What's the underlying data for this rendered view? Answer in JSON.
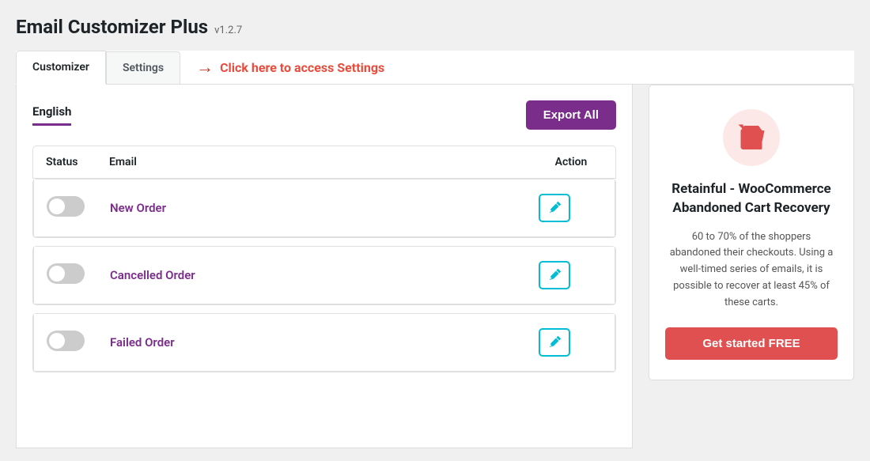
{
  "page": {
    "title": "Email Customizer Plus",
    "version": "v1.2.7"
  },
  "tabs": [
    {
      "id": "customizer",
      "label": "Customizer",
      "active": true
    },
    {
      "id": "settings",
      "label": "Settings",
      "active": false
    }
  ],
  "settings_hint": {
    "arrow": "→",
    "text": "Click here to access Settings"
  },
  "language_tab": {
    "label": "English"
  },
  "export_all_btn": "Export All",
  "table_headers": {
    "status": "Status",
    "email": "Email",
    "action": "Action"
  },
  "email_rows": [
    {
      "id": "new-order",
      "name": "New Order",
      "enabled": false
    },
    {
      "id": "cancelled-order",
      "name": "Cancelled Order",
      "enabled": false
    },
    {
      "id": "failed-order",
      "name": "Failed Order",
      "enabled": false
    }
  ],
  "promo": {
    "title": "Retainful - WooCommerce Abandoned Cart Recovery",
    "description": "60 to 70% of the shoppers abandoned their checkouts. Using a well-timed series of emails, it is possible to recover at least 45% of these carts.",
    "cta": "Get started FREE"
  },
  "colors": {
    "accent_purple": "#7b2d8b",
    "accent_teal": "#00bcd4",
    "accent_red": "#e05050"
  }
}
